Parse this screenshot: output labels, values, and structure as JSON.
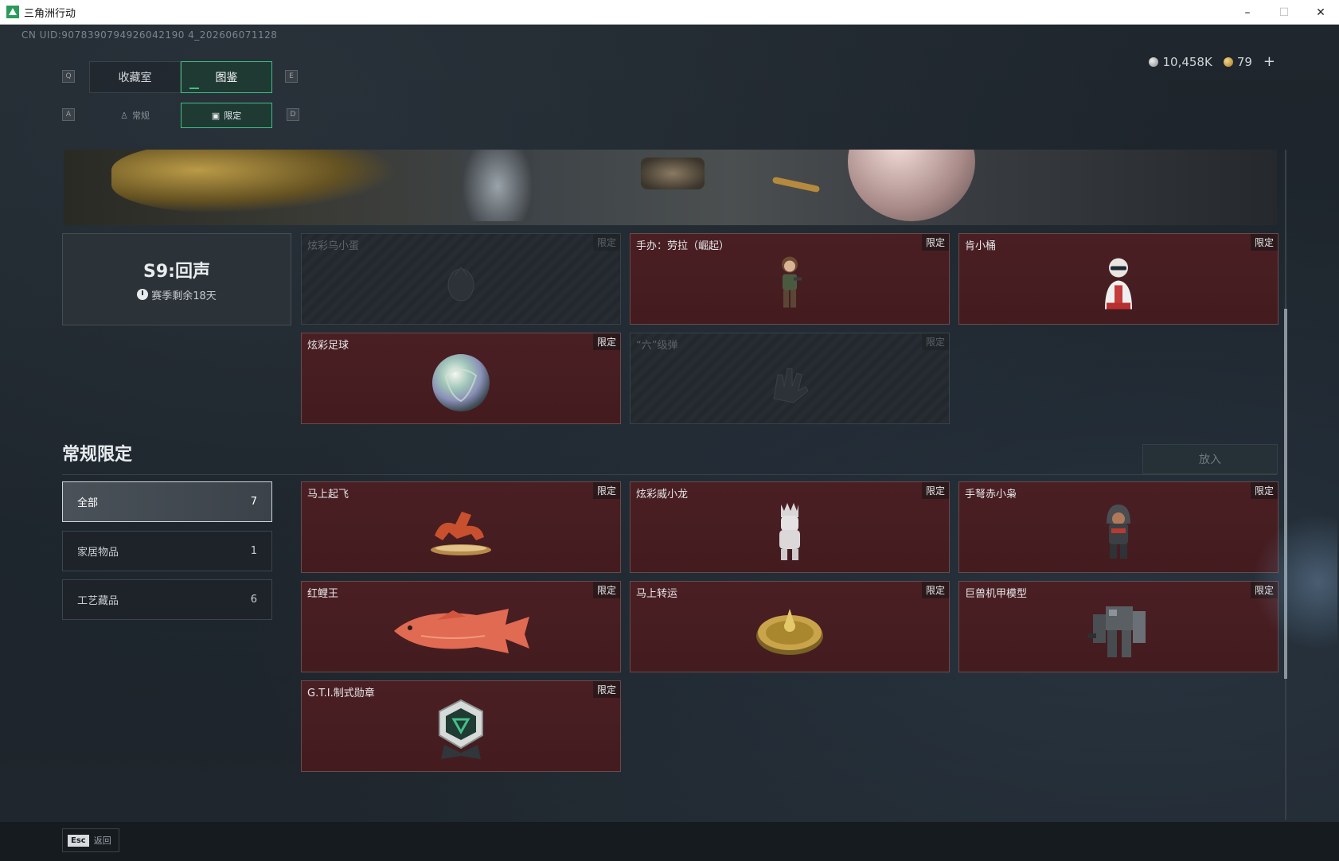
{
  "window": {
    "title": "三角洲行动",
    "controls": {
      "minimize": "–",
      "maximize": "☐",
      "close": "✕"
    }
  },
  "uid": "CN UID:9078390794926042190 4_202606071128",
  "currency": {
    "silver": "10,458K",
    "gold": "79",
    "plus": "+"
  },
  "tabs": {
    "key_left": "Q",
    "key_right": "E",
    "items": [
      {
        "label": "收藏室",
        "active": false
      },
      {
        "label": "图鉴",
        "active": true
      }
    ]
  },
  "subtabs": {
    "key_left": "A",
    "key_right": "D",
    "items": [
      {
        "label": "常规",
        "icon": "figure-icon",
        "active": false
      },
      {
        "label": "限定",
        "icon": "image-icon",
        "active": true
      }
    ]
  },
  "season": {
    "title": "S9:回声",
    "remaining": "赛季剩余18天"
  },
  "season_items": [
    {
      "name": "炫彩乌小蛋",
      "tag": "限定",
      "locked": true,
      "icon": "egg-icon"
    },
    {
      "name": "手办：劳拉（崛起）",
      "tag": "限定",
      "locked": false,
      "icon": "figurine-icon"
    },
    {
      "name": "肯小桶",
      "tag": "限定",
      "locked": false,
      "icon": "bust-icon"
    },
    {
      "name": "炫彩足球",
      "tag": "限定",
      "locked": false,
      "icon": "ball-icon"
    },
    {
      "name": "“六”级弹",
      "tag": "限定",
      "locked": true,
      "icon": "hand-icon"
    }
  ],
  "section": {
    "title": "常规限定",
    "put_button": "放入"
  },
  "filters": [
    {
      "label": "全部",
      "count": "7",
      "active": true
    },
    {
      "label": "家居物品",
      "count": "1",
      "active": false
    },
    {
      "label": "工艺藏品",
      "count": "6",
      "active": false
    }
  ],
  "regular_items": [
    {
      "name": "马上起飞",
      "tag": "限定",
      "icon": "horse-icon"
    },
    {
      "name": "炫彩威小龙",
      "tag": "限定",
      "icon": "dragon-figure-icon"
    },
    {
      "name": "手弩赤小枭",
      "tag": "限定",
      "icon": "hooded-figure-icon"
    },
    {
      "name": "红鲤王",
      "tag": "限定",
      "icon": "fish-icon"
    },
    {
      "name": "马上转运",
      "tag": "限定",
      "icon": "wheel-icon"
    },
    {
      "name": "巨兽机甲模型",
      "tag": "限定",
      "icon": "mech-icon"
    },
    {
      "name": "G.T.I.制式勋章",
      "tag": "限定",
      "icon": "medal-icon"
    }
  ],
  "footer": {
    "esc_key": "Esc",
    "esc_label": "返回"
  }
}
